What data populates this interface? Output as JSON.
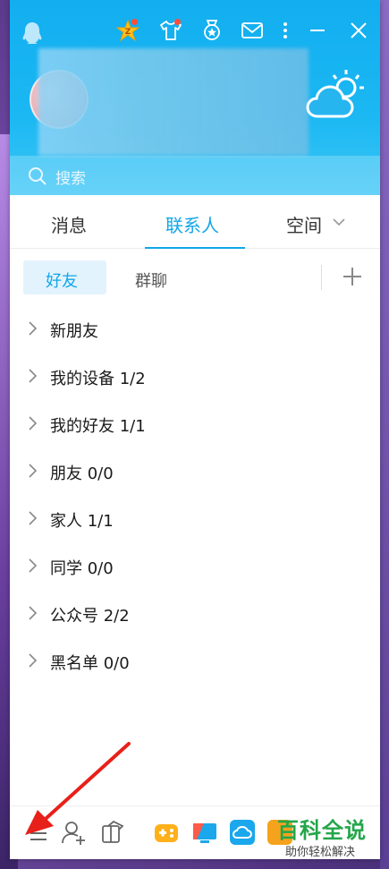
{
  "search": {
    "placeholder": "搜索"
  },
  "tabs": [
    {
      "label": "消息"
    },
    {
      "label": "联系人"
    },
    {
      "label": "空间"
    }
  ],
  "subtabs": {
    "friends": "好友",
    "groups": "群聊"
  },
  "contacts": [
    {
      "label": "新朋友"
    },
    {
      "label": "我的设备 1/2"
    },
    {
      "label": "我的好友 1/1"
    },
    {
      "label": "朋友 0/0"
    },
    {
      "label": "家人 1/1"
    },
    {
      "label": "同学 0/0"
    },
    {
      "label": "公众号 2/2"
    },
    {
      "label": "黑名单 0/0"
    }
  ],
  "watermark": {
    "main": "百科全说",
    "sub": "助你轻松解决"
  },
  "colors": {
    "accent": "#12a6e8",
    "header": "#1bb8f3",
    "arrow": "#e8201a",
    "watermark": "#23a64a"
  },
  "icons": {
    "titlebar": [
      "qq-logo-icon",
      "vip-star-icon",
      "skin-shirt-icon",
      "badge-medal-icon",
      "mail-icon",
      "more-vert-icon",
      "minimize-icon",
      "close-icon"
    ],
    "bottombar": [
      "menu-icon",
      "add-friend-icon",
      "apps-icon",
      "game-icon",
      "screen-share-icon",
      "cloud-icon"
    ]
  }
}
